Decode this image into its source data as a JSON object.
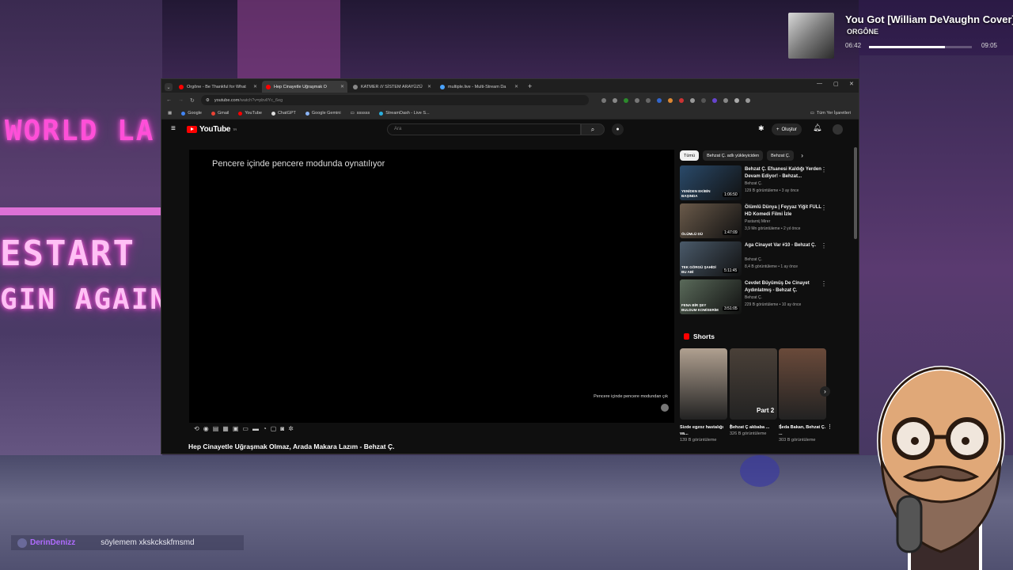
{
  "background": {
    "signs": [
      "WORLD LA",
      "ESTART",
      "GIN AGAIN"
    ]
  },
  "music": {
    "title": "You Got [William DeVaughn Cover]",
    "artist": "ORGÔNE",
    "elapsed": "06:42",
    "total": "09:05",
    "progress": 0.74
  },
  "browser": {
    "tabs": [
      {
        "label": "Orgône - Be Thankful for What",
        "color": "#ff0000",
        "active": false
      },
      {
        "label": "Hep Cinayetle Uğraşmak O",
        "color": "#ff0000",
        "active": true
      },
      {
        "label": "KATMER /// SİSTEM ARAYÜZÜ",
        "color": "#888888",
        "active": false
      },
      {
        "label": "multiple.live - Multi-Stream Da",
        "color": "#4aa3ff",
        "active": false
      }
    ],
    "new_tab": "+",
    "url": "youtube.com",
    "url_path": "/watch?v=pbvllYc_6eg",
    "bookmarks": [
      "Google",
      "Gmail",
      "YouTube",
      "ChatGPT",
      "Google Gemini",
      "ssssss",
      "StreamDash - Live S..."
    ],
    "bookmarks_all": "Tüm Yer İşaretleri"
  },
  "youtube": {
    "logo": "YouTube",
    "logo_sup": "TR",
    "search_placeholder": "Ara",
    "create_label": "Oluştur",
    "pip_message": "Pencere içinde pencere modunda oynatılıyor",
    "pip_exit": "Pencere içinde pencere modundan çık",
    "video_title": "Hep Cinayetle Uğraşmak Olmaz, Arada Makara Lazım - Behzat Ç.",
    "chips": [
      "Tümü",
      "Behzat Ç. adlı yükleyiciden",
      "Behzat Ç."
    ],
    "recommendations": [
      {
        "title": "Behzat Ç. Efsanesi Kaldığı Yerden Devam Ediyor! - Behzat...",
        "channel": "Behzat Ç.",
        "meta": "129 B görüntüleme • 3 ay önce",
        "duration": "1:06:50",
        "overlay": "YENİDEN EKİBİN BAŞINDA",
        "thumb": "#2a4a6a"
      },
      {
        "title": "Ölümlü Dünya | Feyyaz Yiğit FULL HD Komedi Filmi İzle",
        "channel": "Pastarnij Mirer",
        "meta": "3,9 Mn görüntüleme • 2 yıl önce",
        "duration": "1:47:09",
        "overlay": "ÖLÜMLÜ DÜ",
        "thumb": "#6a5a4a"
      },
      {
        "title": "Aga Cinayet Var #10 - Behzat Ç.",
        "channel": "Behzat Ç.",
        "meta": "8,4 B görüntüleme • 1 ay önce",
        "duration": "5:11:45",
        "overlay": "TEK GÖRGÜ ŞAHİDİ BU ABİ",
        "thumb": "#4a5a6a"
      },
      {
        "title": "Cevdet Büyümüş De Cinayet Aydınlatmış - Behzat Ç.",
        "channel": "Behzat Ç.",
        "meta": "229 B görüntüleme • 10 ay önce",
        "duration": "3:51:05",
        "overlay": "FENA BİR ŞEY BULDUM KOMİSERİM",
        "thumb": "#5a6a5a"
      }
    ],
    "shorts_heading": "Shorts",
    "shorts": [
      {
        "title": "Sizde egzoz hastalığı va...",
        "views": "139 B görüntüleme",
        "thumb": "#b0a090",
        "overlay": ""
      },
      {
        "title": "Behzat Ç akbaba ...",
        "views": "326 B görüntüleme",
        "thumb": "#4a4038",
        "overlay": "Part 2"
      },
      {
        "title": "Seda Bakan, Behzat Ç. ...",
        "views": "303 B görüntüleme",
        "thumb": "#6a4a3a",
        "overlay": ""
      }
    ]
  },
  "chat": {
    "user": "DerinDenizz",
    "message": "söylemem xkskckskfmsmd"
  }
}
